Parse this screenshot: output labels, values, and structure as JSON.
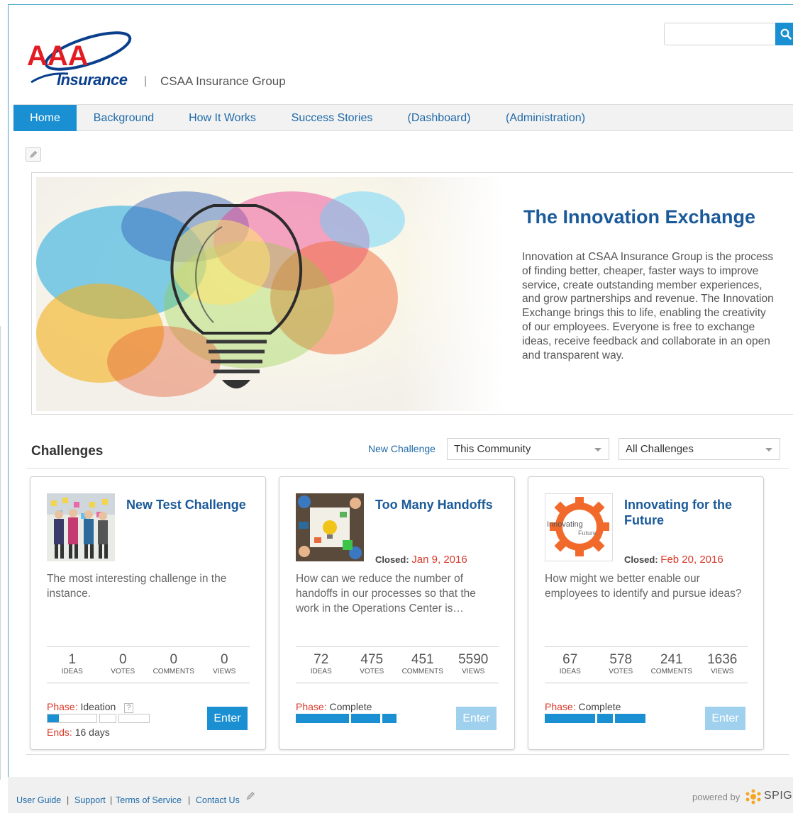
{
  "header": {
    "brand_logo": "AAA",
    "brand_tag": "Insurance",
    "separator": "|",
    "company": "CSAA Insurance Group",
    "search": {
      "placeholder": ""
    }
  },
  "nav": {
    "items": [
      {
        "label": "Home",
        "active": true
      },
      {
        "label": "Background"
      },
      {
        "label": "How It Works"
      },
      {
        "label": "Success Stories"
      },
      {
        "label": "(Dashboard)"
      },
      {
        "label": "(Administration)"
      }
    ]
  },
  "hero": {
    "title": "The Innovation Exchange",
    "text": "Innovation at CSAA Insurance Group is the process of finding better, cheaper, faster ways to improve service, create outstanding member experiences, and grow partnerships and revenue. The Innovation Exchange brings this to life, enabling the creativity of our employees. Everyone is free to exchange ideas, receive feedback and collaborate in an open and transparent way."
  },
  "challenges": {
    "heading": "Challenges",
    "new_challenge": "New Challenge",
    "filter_scope": "This Community",
    "filter_type": "All Challenges",
    "stat_labels": {
      "ideas": "IDEAS",
      "votes": "VOTES",
      "comments": "COMMENTS",
      "views": "VIEWS"
    },
    "phase_key": "Phase:",
    "closed_key": "Closed:",
    "ends_key": "Ends:",
    "enter_label": "Enter",
    "help_mark": "?",
    "cards": [
      {
        "name": "New Test Challenge",
        "closed": "",
        "description": "The most interesting challenge in the instance.",
        "ideas": "1",
        "votes": "0",
        "comments": "0",
        "views": "0",
        "phase": "Ideation",
        "ends": "16 days",
        "progress_fraction": 0.11,
        "enter_enabled": true
      },
      {
        "name": "Too Many Handoffs",
        "closed": "Jan 9, 2016",
        "description": "How can we reduce the number of handoffs in our processes so that the work in the Operations Center is…",
        "ideas": "72",
        "votes": "475",
        "comments": "451",
        "views": "5590",
        "phase": "Complete",
        "progress_fraction": 1.0,
        "enter_enabled": false
      },
      {
        "name": "Innovating for the Future",
        "closed": "Feb 20, 2016",
        "description": "How might we better enable our employees to identify and pursue ideas?",
        "ideas": "67",
        "votes": "578",
        "comments": "241",
        "views": "1636",
        "phase": "Complete",
        "thumb_text": "Innovating",
        "thumb_sub": "Future",
        "progress_fraction": 1.0,
        "enter_enabled": false
      }
    ]
  },
  "footer": {
    "links": [
      "User Guide",
      "Support",
      "Terms of Service",
      "Contact Us"
    ],
    "separators": [
      "|",
      "|",
      "|"
    ],
    "powered_by": "powered by",
    "vendor": "SPIGIT"
  },
  "colors": {
    "accent": "#1a8fd1",
    "link": "#1f6aa8",
    "title": "#1b5a99",
    "alert": "#d93a2b",
    "enter_disabled": "#9fd0ee"
  }
}
